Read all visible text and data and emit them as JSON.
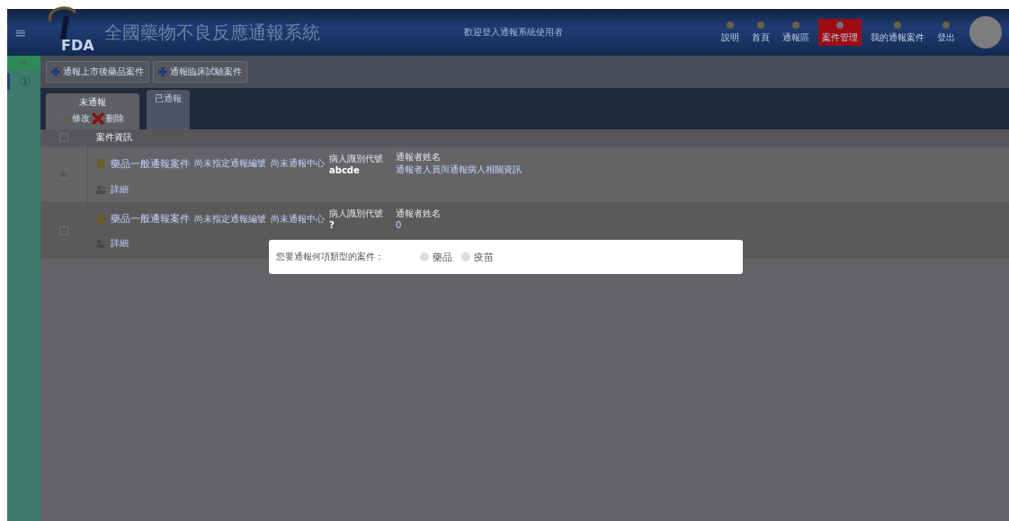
{
  "header": {
    "menu_icon": "≡",
    "logo_text": "FDA",
    "title": "全國藥物不良反應通報系統",
    "user_info": "歡迎登入通報系統使用者",
    "nav": [
      {
        "label": "說明",
        "selected": false
      },
      {
        "label": "首頁",
        "selected": false
      },
      {
        "label": "通報區",
        "selected": false
      },
      {
        "label": "案件管理",
        "selected": true
      },
      {
        "label": "我的通報案件",
        "selected": false
      },
      {
        "label": "登出",
        "selected": false
      }
    ]
  },
  "sidebar": {
    "items": [
      {
        "label": "①",
        "selected": true
      }
    ]
  },
  "toolbar": {
    "buttons": [
      "通報上市後藥品案件",
      "通報臨床試驗案件"
    ]
  },
  "tabs": [
    {
      "label": "未通報",
      "selected": true,
      "actions": [
        "修改",
        "刪除"
      ]
    },
    {
      "label": "已通報",
      "selected": false
    }
  ],
  "table": {
    "select_all_checked": false,
    "columns": [
      "案件資訊"
    ],
    "rows": [
      {
        "checked": false,
        "case_type": "藥品一般通報案件",
        "number": "尚未指定通報編號",
        "center": "尚未通報中心",
        "label_1": "病人識別代號",
        "value_1": "abcde",
        "label_2": "通報者姓名",
        "value_2": "通報者人員與通報病人相關資訊",
        "link": "詳細"
      },
      {
        "checked": false,
        "case_type": "藥品一般通報案件",
        "number": "尚未指定通報編號",
        "center": "尚未通報中心",
        "label_1": "病人識別代號",
        "value_1": "?",
        "label_2": "通報者姓名",
        "value_2": "0",
        "link": "詳細"
      }
    ]
  },
  "dialog": {
    "question": "您要通報何項類型的案件：",
    "options": [
      {
        "label": "藥品",
        "selected": false
      },
      {
        "label": "疫苗",
        "selected": false
      }
    ]
  }
}
